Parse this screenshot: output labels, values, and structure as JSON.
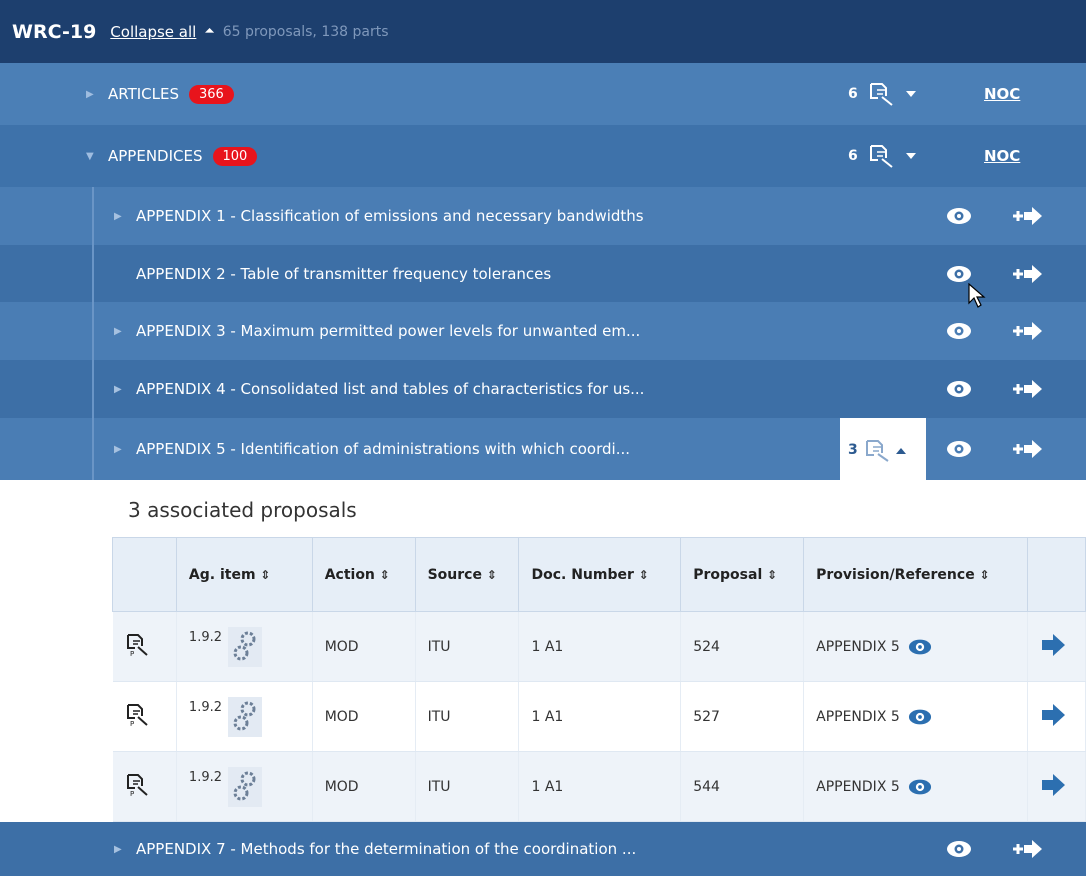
{
  "header": {
    "title": "WRC-19",
    "collapse_label": "Collapse all",
    "caret_icon": "double-chevron-up-icon",
    "summary": "65 proposals, 138 parts"
  },
  "sections": [
    {
      "label": "ARTICLES",
      "badge": "366",
      "count": "6",
      "noc": "NOC",
      "expanded": false
    },
    {
      "label": "APPENDICES",
      "badge": "100",
      "count": "6",
      "noc": "NOC",
      "expanded": true
    }
  ],
  "appendices": [
    {
      "label": "APPENDIX 1 - Classification of emissions and necessary bandwidths",
      "has_children": true
    },
    {
      "label": "APPENDIX 2 - Table of transmitter frequency tolerances",
      "has_children": false
    },
    {
      "label": "APPENDIX 3 - Maximum permitted power levels for unwanted em...",
      "has_children": true
    },
    {
      "label": "APPENDIX 4 - Consolidated list and tables of characteristics for us...",
      "has_children": true
    },
    {
      "label": "APPENDIX 5 - Identification of administrations with which coordi...",
      "has_children": true,
      "proposals_count": "3"
    },
    {
      "label": "APPENDIX 7 - Methods for the determination of the coordination ...",
      "has_children": true
    }
  ],
  "associated": {
    "title": "3 associated proposals",
    "columns": [
      "Ag. item",
      "Action",
      "Source",
      "Doc. Number",
      "Proposal",
      "Provision/Reference"
    ],
    "sort_glyph": "⇕",
    "rows": [
      {
        "ag_item": "1.9.2",
        "action": "MOD",
        "source": "ITU",
        "doc_number": "1 A1",
        "proposal": "524",
        "reference": "APPENDIX 5"
      },
      {
        "ag_item": "1.9.2",
        "action": "MOD",
        "source": "ITU",
        "doc_number": "1 A1",
        "proposal": "527",
        "reference": "APPENDIX 5"
      },
      {
        "ag_item": "1.9.2",
        "action": "MOD",
        "source": "ITU",
        "doc_number": "1 A1",
        "proposal": "544",
        "reference": "APPENDIX 5"
      }
    ]
  },
  "colors": {
    "header_bg": "#1d3f6e",
    "row_bg_light": "#4b7fb6",
    "row_bg_dark": "#3e72aa",
    "badge": "#e8141c",
    "accent": "#2c6fb0"
  }
}
